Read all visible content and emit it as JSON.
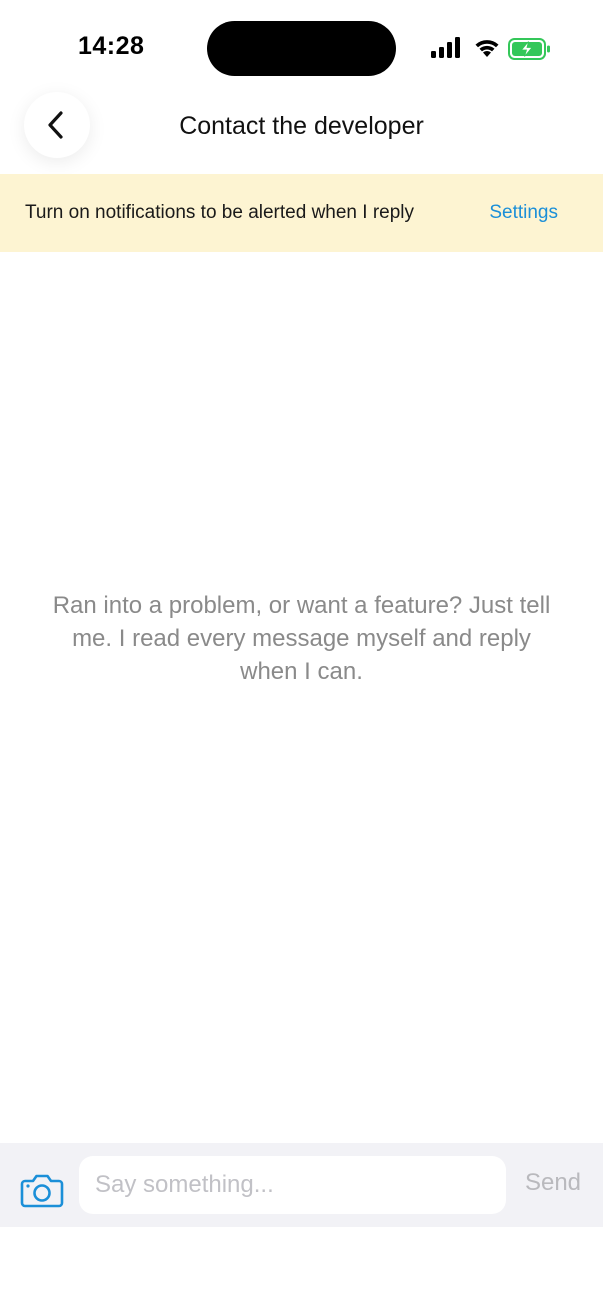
{
  "status_bar": {
    "time": "14:28",
    "icons": [
      "cellular-signal-icon",
      "wifi-icon",
      "battery-charging-icon"
    ],
    "battery_color": "#34c759"
  },
  "header": {
    "back_icon": "chevron-left-icon",
    "title": "Contact the developer"
  },
  "notification_banner": {
    "text": "Turn on notifications to be alerted when I reply",
    "action_label": "Settings",
    "background": "#fdf4d2",
    "action_color": "#1b8fd8"
  },
  "empty_state": {
    "message": "Ran into a problem, or want a feature? Just tell me. I read every message myself and reply when I can."
  },
  "composer": {
    "camera_icon": "camera-icon",
    "input_value": "",
    "input_placeholder": "Say something...",
    "send_label": "Send"
  }
}
